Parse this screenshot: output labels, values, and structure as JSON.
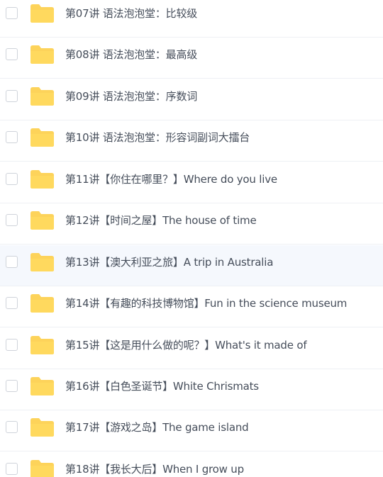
{
  "file_list": {
    "items": [
      {
        "name": "第07讲 语法泡泡堂：比较级",
        "icon": "folder-icon"
      },
      {
        "name": "第08讲 语法泡泡堂：最高级",
        "icon": "folder-icon"
      },
      {
        "name": "第09讲 语法泡泡堂：序数词",
        "icon": "folder-icon"
      },
      {
        "name": "第10讲 语法泡泡堂：形容词副词大擂台",
        "icon": "folder-icon"
      },
      {
        "name": "第11讲【你住在哪里？】Where do you live",
        "icon": "folder-icon"
      },
      {
        "name": "第12讲【时间之屋】The house of time",
        "icon": "folder-icon"
      },
      {
        "name": "第13讲【澳大利亚之旅】A trip in Australia",
        "icon": "folder-icon"
      },
      {
        "name": "第14讲【有趣的科技博物馆】Fun in the science museum",
        "icon": "folder-icon"
      },
      {
        "name": "第15讲【这是用什么做的呢？】What's it made of",
        "icon": "folder-icon"
      },
      {
        "name": "第16讲【白色圣诞节】White Chrismats",
        "icon": "folder-icon"
      },
      {
        "name": "第17讲【游戏之岛】The game island",
        "icon": "folder-icon"
      },
      {
        "name": "第18讲【我长大后】When I grow up",
        "icon": "folder-icon"
      }
    ],
    "highlight_color": "#f5f8fd",
    "folder_color": "#fdd35a"
  }
}
